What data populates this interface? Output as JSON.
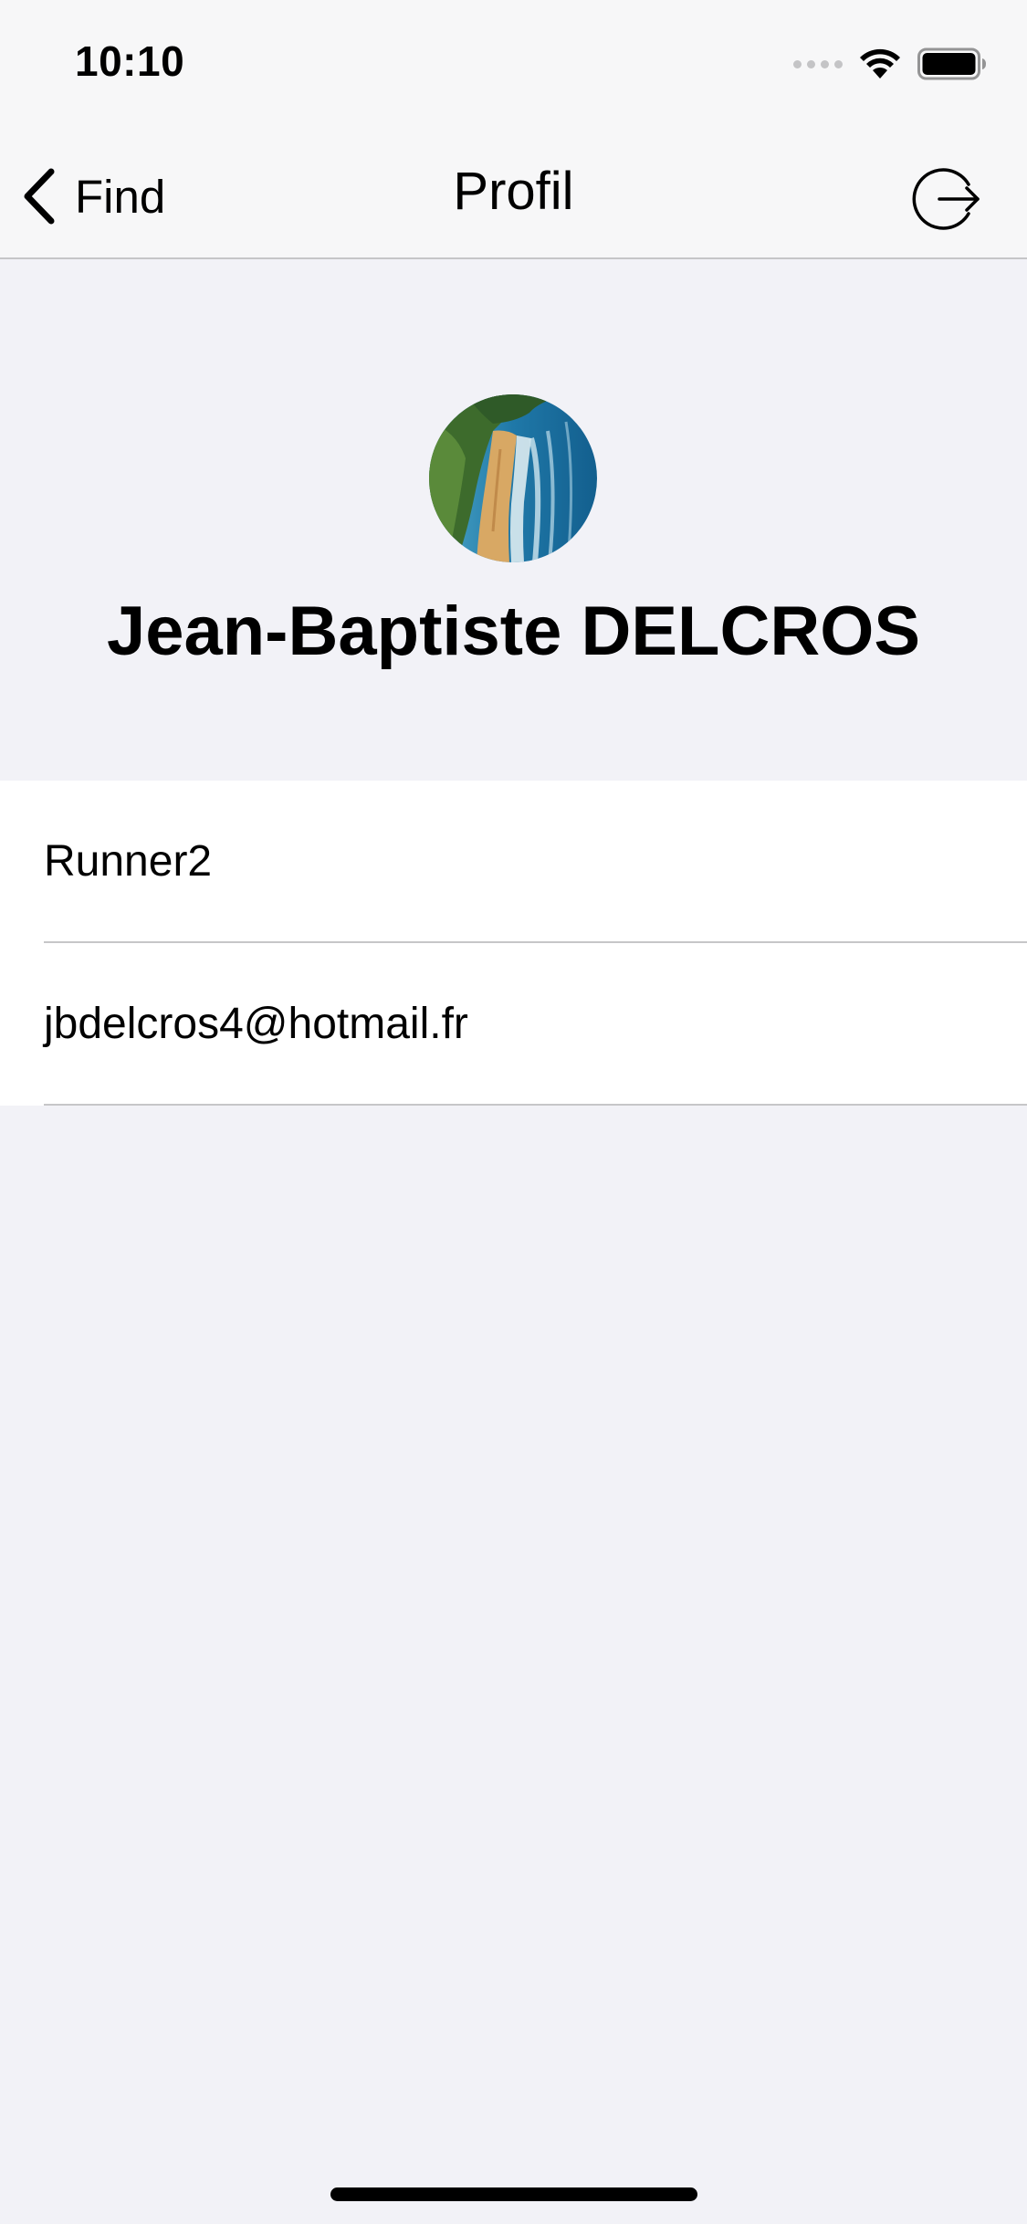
{
  "status_bar": {
    "time": "10:10",
    "icons": [
      "signal-dots-icon",
      "wifi-icon",
      "battery-icon"
    ]
  },
  "nav": {
    "back_label": "Find",
    "title": "Profil",
    "logout_icon": "logout-icon"
  },
  "profile": {
    "avatar": "avatar-image",
    "name": "Jean-Baptiste DELCROS"
  },
  "info": {
    "rows": [
      {
        "value": "Runner2"
      },
      {
        "value": "jbdelcros4@hotmail.fr"
      }
    ]
  },
  "colors": {
    "background": "#f2f2f7",
    "bar_background": "#f7f7f8",
    "separator": "#c6c6c8"
  }
}
